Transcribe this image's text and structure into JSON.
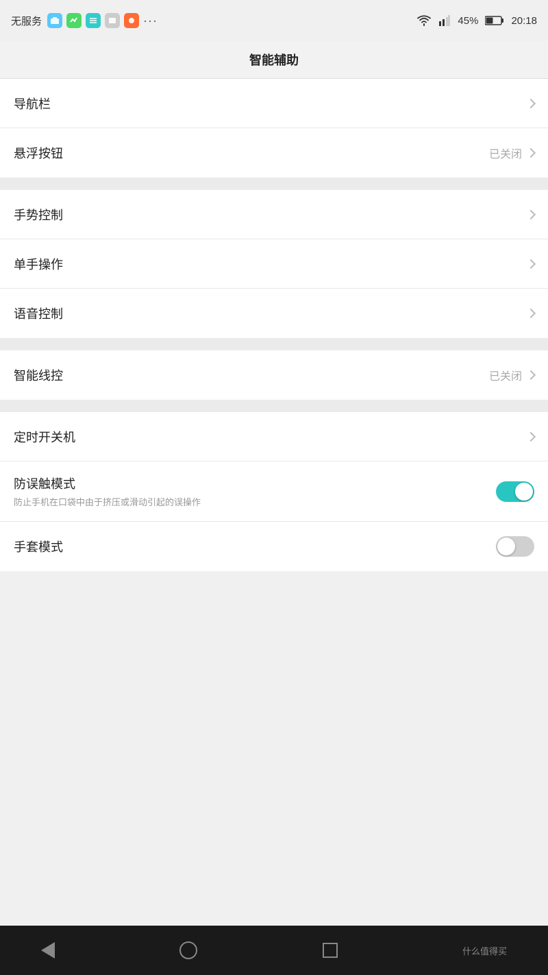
{
  "statusBar": {
    "carrier": "无服务",
    "battery": "45%",
    "time": "20:18"
  },
  "titleBar": {
    "title": "智能辅助"
  },
  "groups": [
    {
      "items": [
        {
          "id": "navigation-bar",
          "label": "导航栏",
          "status": "",
          "hasChevron": true,
          "toggle": null,
          "desc": ""
        },
        {
          "id": "floating-button",
          "label": "悬浮按钮",
          "status": "已关闭",
          "hasChevron": true,
          "toggle": null,
          "desc": ""
        }
      ]
    },
    {
      "items": [
        {
          "id": "gesture-control",
          "label": "手势控制",
          "status": "",
          "hasChevron": true,
          "toggle": null,
          "desc": ""
        },
        {
          "id": "single-hand",
          "label": "单手操作",
          "status": "",
          "hasChevron": true,
          "toggle": null,
          "desc": ""
        },
        {
          "id": "voice-control",
          "label": "语音控制",
          "status": "",
          "hasChevron": true,
          "toggle": null,
          "desc": ""
        }
      ]
    },
    {
      "items": [
        {
          "id": "smart-wire",
          "label": "智能线控",
          "status": "已关闭",
          "hasChevron": true,
          "toggle": null,
          "desc": ""
        }
      ]
    },
    {
      "items": [
        {
          "id": "scheduled-power",
          "label": "定时开关机",
          "status": "",
          "hasChevron": true,
          "toggle": null,
          "desc": ""
        },
        {
          "id": "anti-mistouch",
          "label": "防误触模式",
          "status": "",
          "hasChevron": false,
          "toggle": "on",
          "desc": "防止手机在口袋中由于挤压或滑动引起的误操作"
        },
        {
          "id": "glove-mode",
          "label": "手套模式",
          "status": "",
          "hasChevron": false,
          "toggle": "off",
          "desc": ""
        }
      ]
    }
  ],
  "bottomNav": {
    "logoText": "什么值得买"
  }
}
